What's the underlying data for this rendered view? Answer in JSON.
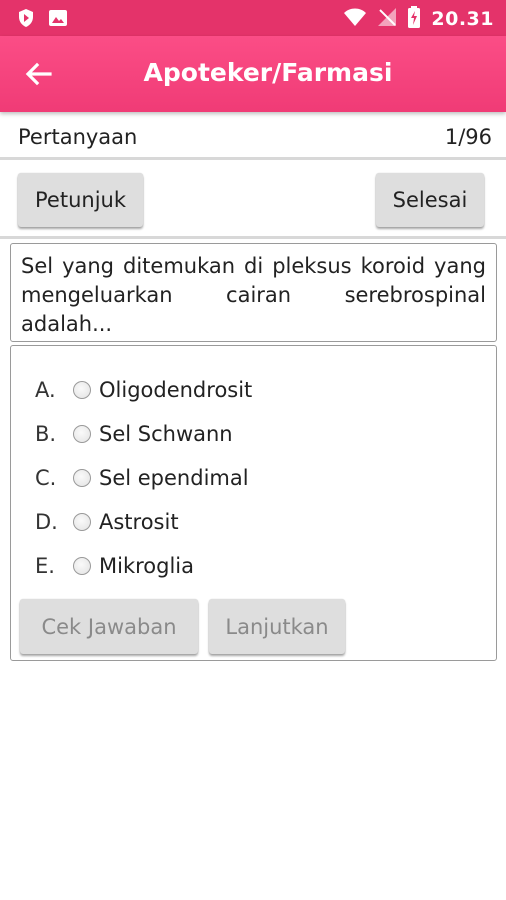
{
  "statusbar": {
    "time": "20.31",
    "icons": [
      "shield-app-icon",
      "image-icon",
      "wifi-icon",
      "no-signal-icon",
      "battery-charging-icon"
    ]
  },
  "appbar": {
    "title": "Apoteker/Farmasi",
    "back_icon": "arrow-left-icon",
    "color": "#f8437d"
  },
  "question_header": {
    "label": "Pertanyaan",
    "counter": "1/96"
  },
  "buttons": {
    "hint": "Petunjuk",
    "finish": "Selesai",
    "check": "Cek Jawaban",
    "next": "Lanjutkan"
  },
  "question": {
    "text": "Sel yang ditemukan di pleksus koroid yang mengeluarkan cairan serebrospinal adalah..."
  },
  "options": [
    {
      "letter": "A.",
      "text": "Oligodendrosit",
      "selected": false
    },
    {
      "letter": "B.",
      "text": "Sel Schwann",
      "selected": false
    },
    {
      "letter": "C.",
      "text": "Sel ependimal",
      "selected": false
    },
    {
      "letter": "D.",
      "text": "Astrosit",
      "selected": false
    },
    {
      "letter": "E.",
      "text": "Mikroglia",
      "selected": false
    }
  ]
}
